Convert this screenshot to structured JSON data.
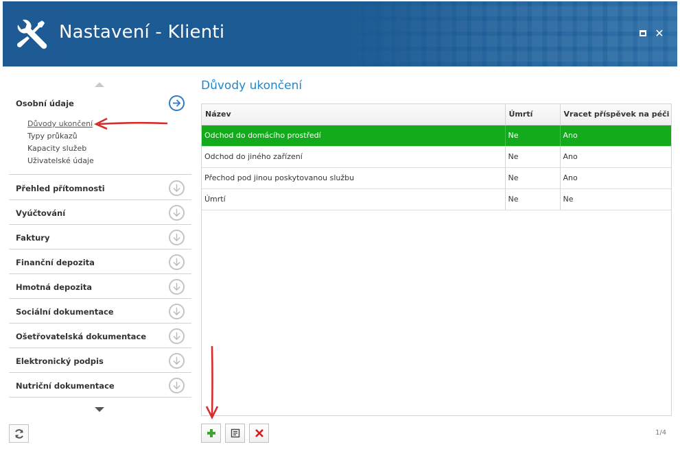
{
  "window": {
    "title": "Nastavení - Klienti",
    "brand_color": "#1e5b95"
  },
  "sidebar": {
    "active_section": {
      "label": "Osobní údaje",
      "items": [
        {
          "label": "Důvody ukončení",
          "selected": true
        },
        {
          "label": "Typy průkazů",
          "selected": false
        },
        {
          "label": "Kapacity služeb",
          "selected": false
        },
        {
          "label": "Uživatelské údaje",
          "selected": false
        }
      ]
    },
    "sections": [
      {
        "label": "Přehled přítomnosti"
      },
      {
        "label": "Vyúčtování"
      },
      {
        "label": "Faktury"
      },
      {
        "label": "Finanční depozita"
      },
      {
        "label": "Hmotná depozita"
      },
      {
        "label": "Sociální dokumentace"
      },
      {
        "label": "Ošetřovatelská dokumentace"
      },
      {
        "label": "Elektronický podpis"
      },
      {
        "label": "Nutriční dokumentace"
      }
    ]
  },
  "main": {
    "title": "Důvody ukončení",
    "columns": [
      "Název",
      "Úmrtí",
      "Vracet příspěvek na péči"
    ],
    "rows": [
      {
        "nazev": "Odchod do domácího prostředí",
        "umrti": "Ne",
        "vracet": "Ano",
        "selected": true
      },
      {
        "nazev": "Odchod do jiného zařízení",
        "umrti": "Ne",
        "vracet": "Ano",
        "selected": false
      },
      {
        "nazev": "Přechod pod jinou poskytovanou službu",
        "umrti": "Ne",
        "vracet": "Ano",
        "selected": false
      },
      {
        "nazev": "Úmrtí",
        "umrti": "Ne",
        "vracet": "Ne",
        "selected": false
      }
    ],
    "selected_row_color": "#13ab1b",
    "pager": "1/4"
  }
}
